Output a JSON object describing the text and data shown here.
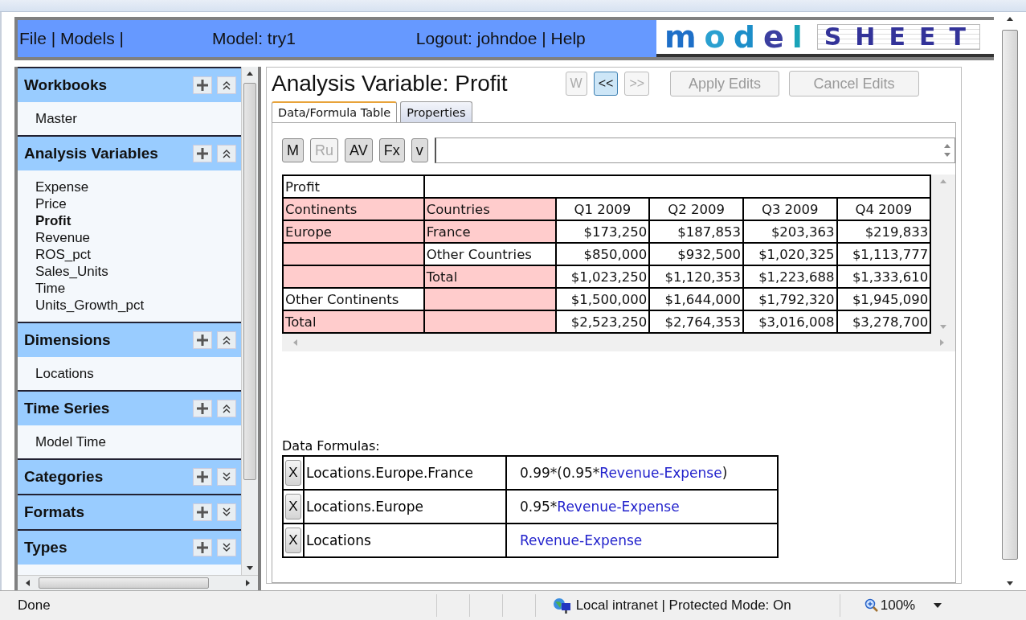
{
  "header": {
    "menu": "File | Models |",
    "model": "Model: try1",
    "account": "Logout: johndoe | Help",
    "logo": {
      "first": "model",
      "second": "SHEET"
    }
  },
  "sidebar": {
    "sections": [
      {
        "title": "Workbooks",
        "expanded": true,
        "items": [
          {
            "label": "Master",
            "selected": false
          }
        ]
      },
      {
        "title": "Analysis Variables",
        "expanded": true,
        "items": [
          {
            "label": "Expense",
            "selected": false
          },
          {
            "label": "Price",
            "selected": false
          },
          {
            "label": "Profit",
            "selected": true
          },
          {
            "label": "Revenue",
            "selected": false
          },
          {
            "label": "ROS_pct",
            "selected": false
          },
          {
            "label": "Sales_Units",
            "selected": false
          },
          {
            "label": "Time",
            "selected": false
          },
          {
            "label": "Units_Growth_pct",
            "selected": false
          }
        ]
      },
      {
        "title": "Dimensions",
        "expanded": true,
        "items": [
          {
            "label": "Locations",
            "selected": false
          }
        ]
      },
      {
        "title": "Time Series",
        "expanded": true,
        "items": [
          {
            "label": "Model Time",
            "selected": false
          }
        ]
      },
      {
        "title": "Categories",
        "expanded": false
      },
      {
        "title": "Formats",
        "expanded": false
      },
      {
        "title": "Types",
        "expanded": false
      }
    ]
  },
  "main": {
    "title": "Analysis Variable: Profit",
    "nav_buttons": [
      {
        "label": "W",
        "disabled": true,
        "selected": false
      },
      {
        "label": "<<",
        "disabled": false,
        "selected": true
      },
      {
        "label": ">>",
        "disabled": true,
        "selected": false
      }
    ],
    "action_buttons": [
      {
        "label": "Apply Edits",
        "disabled": true
      },
      {
        "label": "Cancel Edits",
        "disabled": true
      }
    ],
    "tabs": [
      {
        "label": "Data/Formula Table",
        "selected": true
      },
      {
        "label": "Properties",
        "selected": false
      }
    ],
    "tools": [
      {
        "label": "M",
        "disabled": false
      },
      {
        "label": "Ru",
        "disabled": true
      },
      {
        "label": "AV",
        "disabled": false
      },
      {
        "label": "Fx",
        "disabled": false
      },
      {
        "label": "v",
        "disabled": false
      }
    ],
    "table": {
      "title": "Profit",
      "rows": [
        {
          "kind": "header",
          "cells": [
            {
              "text": "Continents",
              "shaded": true
            },
            {
              "text": "Countries",
              "shaded": true
            },
            {
              "text": "Q1 2009",
              "shaded": false
            },
            {
              "text": "Q2 2009",
              "shaded": false
            },
            {
              "text": "Q3 2009",
              "shaded": false
            },
            {
              "text": "Q4 2009",
              "shaded": false
            }
          ]
        },
        {
          "kind": "data",
          "cells": [
            {
              "text": "Europe",
              "shaded": true
            },
            {
              "text": "France",
              "shaded": true
            },
            {
              "text": "$173,250",
              "shaded": false
            },
            {
              "text": "$187,853",
              "shaded": false
            },
            {
              "text": "$203,363",
              "shaded": false
            },
            {
              "text": "$219,833",
              "shaded": false
            }
          ]
        },
        {
          "kind": "data",
          "cells": [
            {
              "shaded": true
            },
            {
              "text": "Other Countries",
              "shaded": false
            },
            {
              "text": "$850,000",
              "shaded": false
            },
            {
              "text": "$932,500",
              "shaded": false
            },
            {
              "text": "$1,020,325",
              "shaded": false
            },
            {
              "text": "$1,113,777",
              "shaded": false
            }
          ]
        },
        {
          "kind": "data",
          "cells": [
            {
              "shaded": true
            },
            {
              "text": "Total",
              "shaded": true
            },
            {
              "text": "$1,023,250",
              "shaded": false
            },
            {
              "text": "$1,120,353",
              "shaded": false
            },
            {
              "text": "$1,223,688",
              "shaded": false
            },
            {
              "text": "$1,333,610",
              "shaded": false
            }
          ]
        },
        {
          "kind": "data",
          "cells": [
            {
              "text": "Other Continents",
              "shaded": false
            },
            {
              "shaded": true
            },
            {
              "text": "$1,500,000",
              "shaded": false
            },
            {
              "text": "$1,644,000",
              "shaded": false
            },
            {
              "text": "$1,792,320",
              "shaded": false
            },
            {
              "text": "$1,945,090",
              "shaded": false
            }
          ]
        },
        {
          "kind": "data",
          "cells": [
            {
              "text": "Total",
              "shaded": true
            },
            {
              "shaded": true
            },
            {
              "text": "$2,523,250",
              "shaded": false
            },
            {
              "text": "$2,764,353",
              "shaded": false
            },
            {
              "text": "$3,016,008",
              "shaded": false
            },
            {
              "text": "$3,278,700",
              "shaded": false
            }
          ]
        }
      ]
    },
    "formulas_label": "Data Formulas:",
    "formulas": [
      {
        "delete": "X",
        "target": "Locations.Europe.France",
        "parts": [
          {
            "kind": "plain",
            "text": "0.99*(0.95*"
          },
          {
            "kind": "link",
            "text": "Revenue-Expense"
          },
          {
            "kind": "plain",
            "text": ")"
          }
        ]
      },
      {
        "delete": "X",
        "target": "Locations.Europe",
        "parts": [
          {
            "kind": "plain",
            "text": "0.95*"
          },
          {
            "kind": "link",
            "text": "Revenue-Expense"
          }
        ]
      },
      {
        "delete": "X",
        "target": "Locations",
        "parts": [
          {
            "kind": "link",
            "text": "Revenue-Expense"
          }
        ]
      }
    ]
  },
  "status_bar": {
    "status": "Done",
    "zone": "Local intranet | Protected Mode: On",
    "zoom": "100%"
  }
}
